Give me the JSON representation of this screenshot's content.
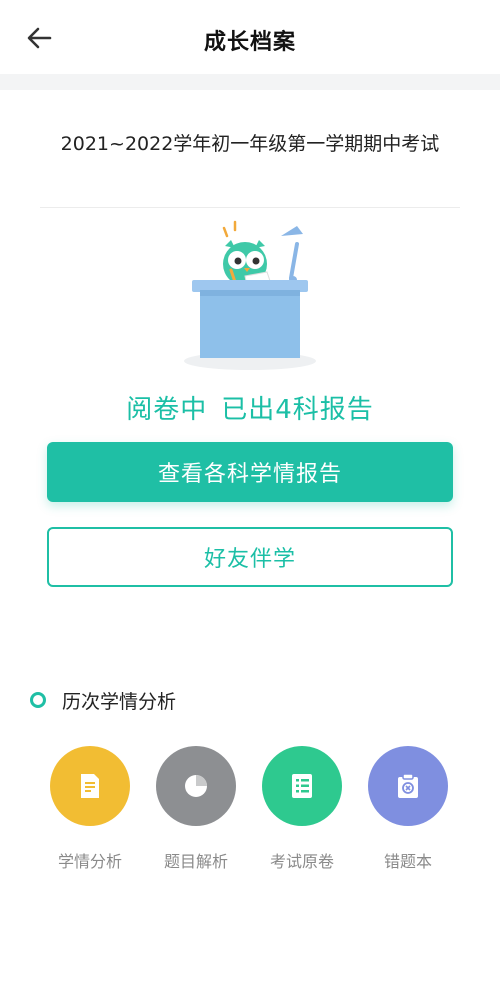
{
  "header": {
    "title": "成长档案"
  },
  "exam": {
    "title": "2021~2022学年初一年级第一学期期中考试"
  },
  "status": {
    "grading": "阅卷中",
    "reports": "已出4科报告"
  },
  "actions": {
    "view_reports": "查看各科学情报告",
    "study_with_friends": "好友伴学"
  },
  "history": {
    "title": "历次学情分析",
    "items": [
      {
        "label": "学情分析",
        "icon": "document-icon",
        "color": "#f2bd33"
      },
      {
        "label": "题目解析",
        "icon": "pie-chart-icon",
        "color": "#8d8f92"
      },
      {
        "label": "考试原卷",
        "icon": "paper-list-icon",
        "color": "#2ec98f"
      },
      {
        "label": "错题本",
        "icon": "clipboard-x-icon",
        "color": "#7f8fe0"
      }
    ]
  },
  "colors": {
    "accent": "#1fbfa5",
    "page_gap": "#f3f4f5"
  }
}
